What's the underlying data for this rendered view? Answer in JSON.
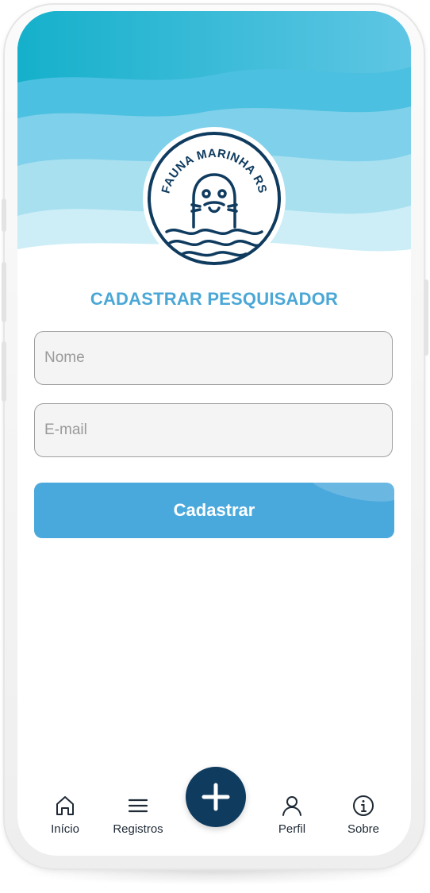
{
  "logo": {
    "text": "FAUNA MARINHA RS",
    "icon": "seal-logo-icon"
  },
  "page": {
    "title": "CADASTRAR PESQUISADOR"
  },
  "form": {
    "name_placeholder": "Nome",
    "email_placeholder": "E-mail",
    "submit_label": "Cadastrar"
  },
  "nav": {
    "items": [
      {
        "label": "Início",
        "icon": "home-icon"
      },
      {
        "label": "Registros",
        "icon": "menu-icon"
      },
      {
        "label": "Perfil",
        "icon": "user-icon"
      },
      {
        "label": "Sobre",
        "icon": "info-icon"
      }
    ],
    "fab_icon": "plus-icon"
  },
  "colors": {
    "accent": "#4aa9dc",
    "title": "#4aa7d6",
    "navy": "#0f3b5f",
    "wave_dark": "#17b3cf",
    "wave_light": "#cdeef7"
  }
}
